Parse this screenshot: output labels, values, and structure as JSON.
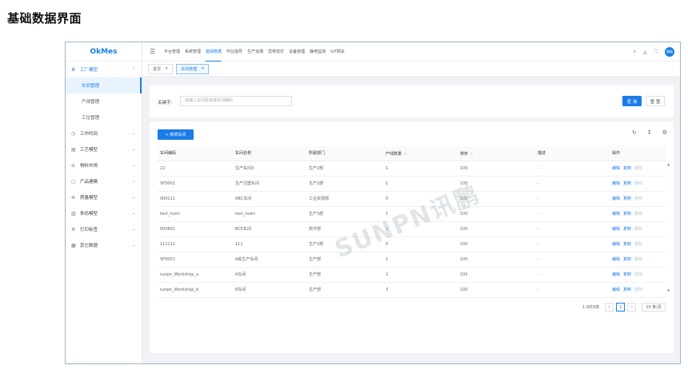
{
  "page_heading": "基础数据界面",
  "sidebar": {
    "brand": "OkMes",
    "groups": [
      {
        "icon": "factory-icon",
        "glyph": "⚙",
        "label": "工厂模型",
        "active": true,
        "children": [
          {
            "label": "车间管理",
            "active": true
          },
          {
            "label": "产线管理",
            "active": false
          },
          {
            "label": "工位管理",
            "active": false
          }
        ]
      },
      {
        "icon": "clock-icon",
        "glyph": "◷",
        "label": "工作时间"
      },
      {
        "icon": "process-icon",
        "glyph": "▤",
        "label": "工艺模型"
      },
      {
        "icon": "material-icon",
        "glyph": "⊖",
        "label": "物料市场"
      },
      {
        "icon": "product-icon",
        "glyph": "▢",
        "label": "产品建模"
      },
      {
        "icon": "quality-icon",
        "glyph": "⊛",
        "label": "质量模型"
      },
      {
        "icon": "barcode-icon",
        "glyph": "▥",
        "label": "条码模型"
      },
      {
        "icon": "print-icon",
        "glyph": "⚙",
        "label": "打印标签"
      },
      {
        "icon": "other-data-icon",
        "glyph": "▦",
        "label": "其它数据"
      }
    ]
  },
  "topnav": {
    "items": [
      "平台管理",
      "系统管理",
      "基础数据",
      "作业指导",
      "生产追溯",
      "异常安灯",
      "设备管理",
      "静电监测",
      "IoT网关"
    ],
    "active_index": 2,
    "avatar_text": "超级"
  },
  "tabs": [
    {
      "label": "首页",
      "active": false
    },
    {
      "label": "车间管理",
      "active": true
    }
  ],
  "search": {
    "label": "关键字:",
    "placeholder": "请输入车间名称或车间编码",
    "query_label": "查 询",
    "reset_label": "重 置"
  },
  "table": {
    "add_label": "+ 新增车间",
    "columns": [
      "车间编码",
      "车间名称",
      "所属部门",
      "产线数量",
      "排序",
      "描述",
      "操作"
    ],
    "sortable": [
      false,
      false,
      false,
      true,
      true,
      false,
      false
    ],
    "actions": [
      "编辑",
      "复制",
      "删除"
    ],
    "rows": [
      [
        "22",
        "生产车间3",
        "生产2部",
        "1",
        "100",
        "-"
      ],
      [
        "SF0002",
        "生产注塑车间",
        "生产2部",
        "1",
        "100",
        "-"
      ],
      [
        "000111",
        "ABC车间",
        "工业资源部",
        "0",
        "100",
        "-"
      ],
      [
        "test_room",
        "test_room",
        "生产3部",
        "1",
        "100",
        "-"
      ],
      [
        "000801",
        "BCE车间",
        "软件部",
        "1",
        "100",
        "-"
      ],
      [
        "111111",
        "111",
        "生产2部",
        "0",
        "100",
        "-"
      ],
      [
        "SF0001",
        "A栋生产车间",
        "生产部",
        "1",
        "100",
        "-"
      ],
      [
        "sunpn_Workshop_a",
        "A车间",
        "生产部",
        "2",
        "100",
        "-"
      ],
      [
        "sunpn_Workshop_b",
        "B车间",
        "生产部",
        "3",
        "100",
        "-"
      ]
    ]
  },
  "pagination": {
    "total_text": "1-9共9条",
    "prev": "<",
    "current": "1",
    "next": ">",
    "page_size": "10 条/页"
  },
  "watermark": "SUNPN讯鹏"
}
